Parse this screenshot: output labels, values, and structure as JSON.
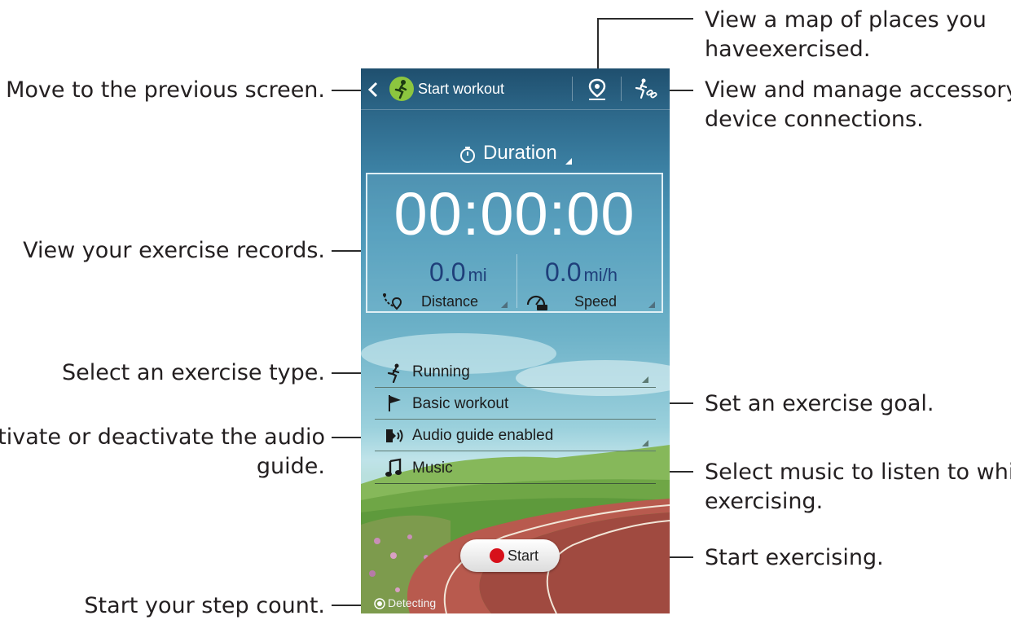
{
  "phone": {
    "header": {
      "back_icon": "chevron-left",
      "logo_icon": "running-figure",
      "title": "Start workout",
      "map_icon": "map-pin",
      "accessory_icon": "runner-link"
    },
    "mode": {
      "icon": "stopwatch",
      "label": "Duration"
    },
    "records": {
      "timer": "00:00:00",
      "distance": {
        "value": "0.0",
        "unit": "mi",
        "label": "Distance",
        "icon": "route-pin"
      },
      "speed": {
        "value": "0.0",
        "unit": "mi/h",
        "label": "Speed",
        "icon": "gauge-avg"
      }
    },
    "list": [
      {
        "icon": "runner",
        "label": "Running"
      },
      {
        "icon": "flag",
        "label": "Basic workout"
      },
      {
        "icon": "speaker",
        "label": "Audio guide enabled"
      },
      {
        "icon": "music-note",
        "label": "Music"
      }
    ],
    "start_button": "Start",
    "detecting": "Detecting"
  },
  "callouts": {
    "previous": "Move to the previous screen.",
    "records": "View your exercise records.",
    "exercise_type": "Select an exercise type.",
    "audio_line1": "Activate or deactivate the audio",
    "audio_line2": "guide.",
    "step_count": "Start your step count.",
    "map_line1": "View a map of places you",
    "map_line2": "haveexercised.",
    "accessory_line1": "View and manage accessory",
    "accessory_line2": "device connections.",
    "goal": "Set an exercise goal.",
    "music_line1": "Select music to listen to while",
    "music_line2": "exercising.",
    "start": "Start exercising."
  }
}
